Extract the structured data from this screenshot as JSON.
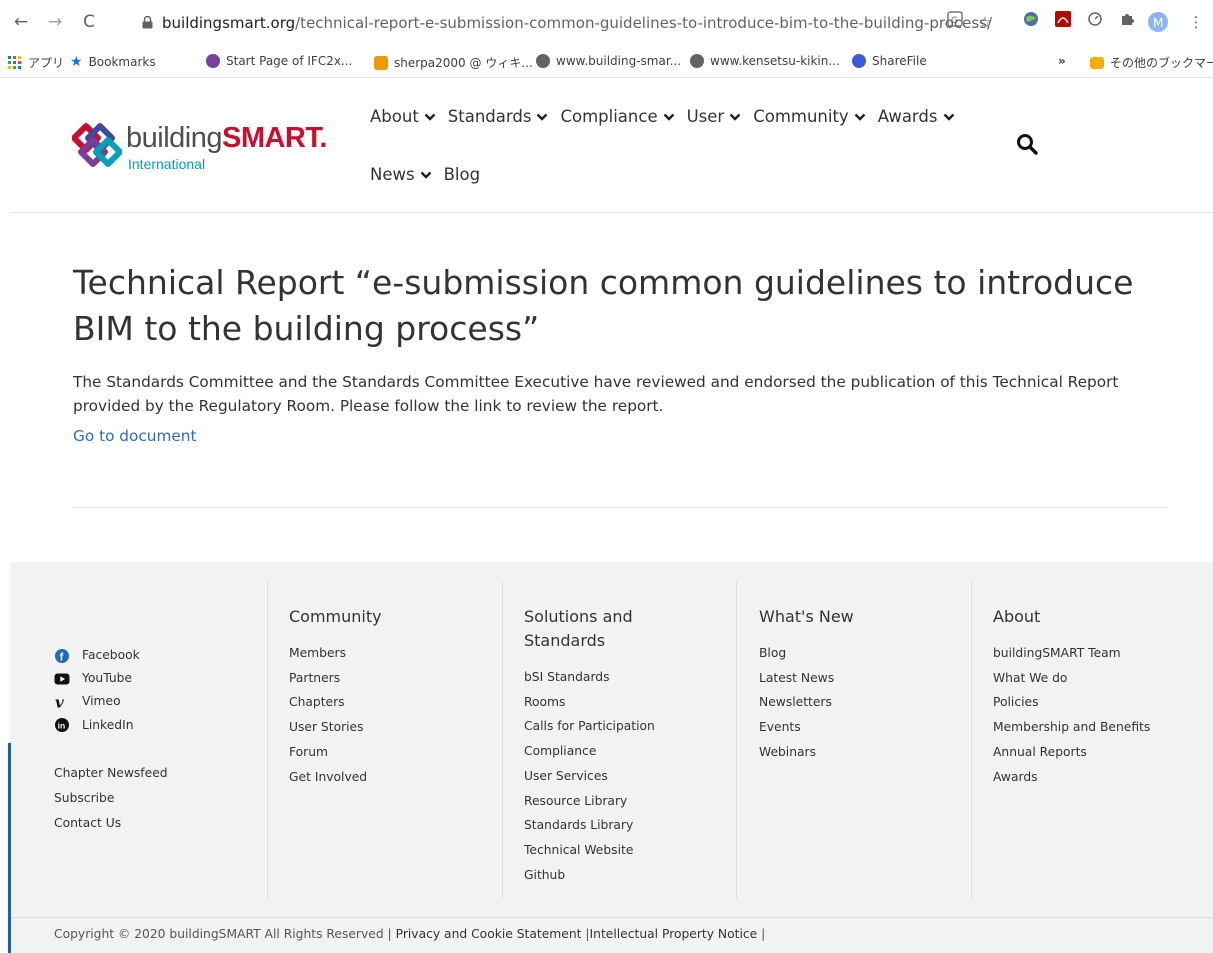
{
  "browser": {
    "back_icon": "arrow-left-icon",
    "forward_icon": "arrow-right-icon",
    "reload_icon": "reload-icon",
    "url_domain": "buildingsmart.org",
    "url_path": "/technical-report-e-submission-common-guidelines-to-introduce-bim-to-the-building-process/",
    "profile_initial": "M"
  },
  "bookmarks_bar": {
    "items": [
      {
        "label": "アプリ",
        "icon": "apps-grid-icon"
      },
      {
        "label": "Bookmarks",
        "icon": "star-icon"
      },
      {
        "label": "Start Page of IFC2x...",
        "icon": "site-favicon-icon"
      },
      {
        "label": "sherpa2000 @ ウィキ...",
        "icon": "site-favicon-icon"
      },
      {
        "label": "www.building-smar...",
        "icon": "globe-icon"
      },
      {
        "label": "www.kensetsu-kikin...",
        "icon": "globe-icon"
      },
      {
        "label": "ShareFile",
        "icon": "sharefile-icon"
      }
    ],
    "overflow_label": "»",
    "other_bookmarks": "その他のブックマーク"
  },
  "site": {
    "logo": {
      "part1": "building",
      "part2": "SMART",
      "suffix": ".",
      "subtitle": "International"
    },
    "nav_row1": [
      "About",
      "Standards",
      "Compliance",
      "User",
      "Community",
      "Awards"
    ],
    "nav_row2": [
      {
        "label": "News",
        "caret": true
      },
      {
        "label": "Blog",
        "caret": false
      }
    ]
  },
  "article": {
    "title": "Technical Report “e-submission common guidelines to introduce BIM to the building process”",
    "body": "The Standards Committee and the Standards Committee Executive have reviewed and endorsed the publication of this Technical Report provided by the Regulatory Room. Please follow the link to review the report.",
    "link": "Go to document"
  },
  "footer": {
    "social": [
      "Facebook",
      "YouTube",
      "Vimeo",
      "LinkedIn"
    ],
    "left_links": [
      "Chapter Newsfeed",
      "Subscribe",
      "Contact Us"
    ],
    "columns": [
      {
        "heading": "Community",
        "items": [
          "Members",
          "Partners",
          "Chapters",
          "User Stories",
          "Forum",
          "Get Involved"
        ]
      },
      {
        "heading": "Solutions and Standards",
        "items": [
          "bSI Standards",
          "Rooms",
          "Calls for Participation",
          "Compliance",
          "User Services",
          "Resource Library",
          "Standards Library",
          "Technical Website",
          "Github"
        ]
      },
      {
        "heading": "What's New",
        "items": [
          "Blog",
          "Latest News",
          "Newsletters",
          "Events",
          "Webinars"
        ]
      },
      {
        "heading": "About",
        "items": [
          "buildingSMART Team",
          "What We do",
          "Policies",
          "Membership and Benefits",
          "Annual Reports",
          "Awards"
        ]
      }
    ],
    "copyright": "Copyright © 2020 buildingSMART All Rights Reserved |",
    "privacy": "Privacy and Cookie Statement",
    "ip_notice": "Intellectual Property Notice",
    "sep": "|"
  },
  "colors": {
    "brand_red": "#c8102e",
    "brand_teal": "#00a3b4",
    "link_blue": "#2f6ea8",
    "footer_bg": "#f2f2f2"
  }
}
